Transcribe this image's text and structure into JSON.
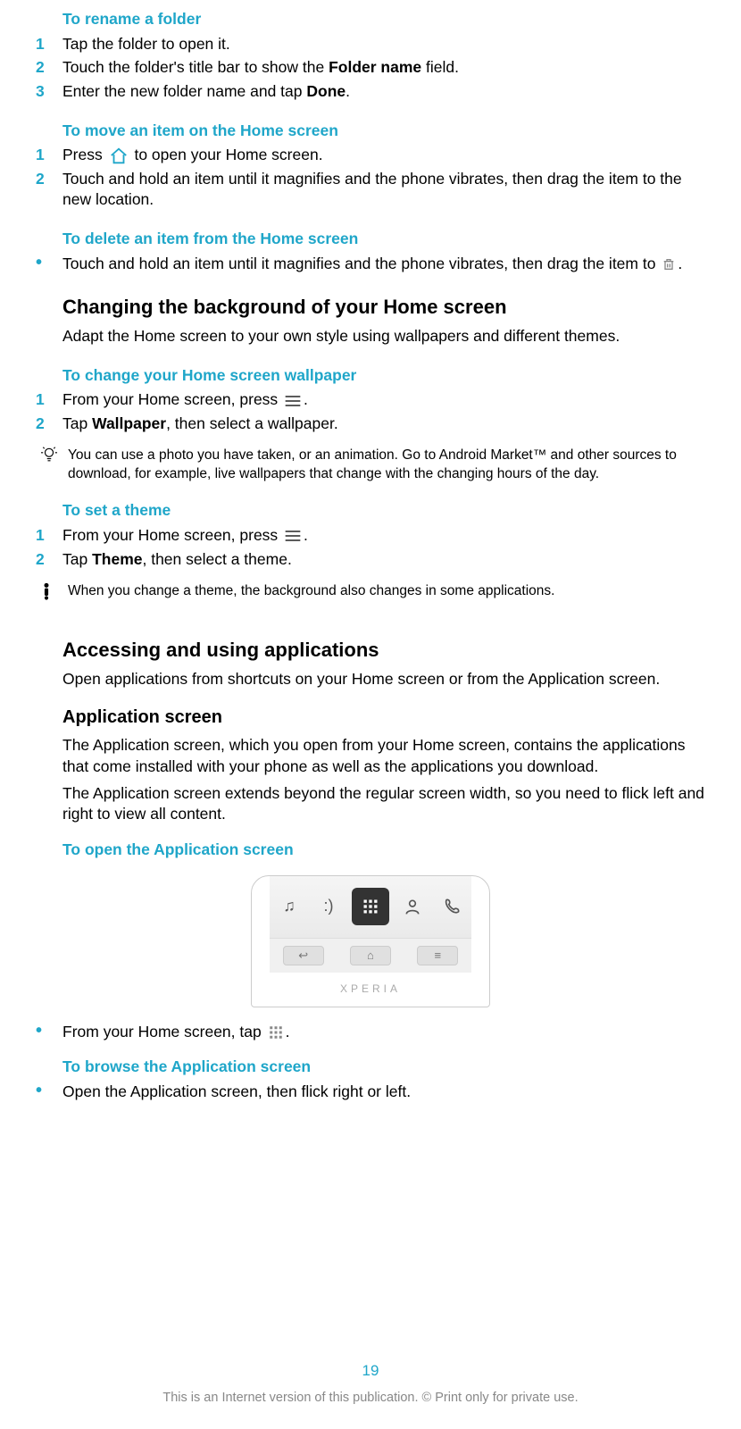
{
  "sec_rename": {
    "title": "To rename a folder",
    "s1_num": "1",
    "s1_txt": "Tap the folder to open it.",
    "s2_num": "2",
    "s2_pre": "Touch the folder's title bar to show the ",
    "s2_bold": "Folder name",
    "s2_post": " field.",
    "s3_num": "3",
    "s3_pre": "Enter the new folder name and tap ",
    "s3_bold": "Done",
    "s3_post": "."
  },
  "sec_move": {
    "title": "To move an item on the Home screen",
    "s1_num": "1",
    "s1_pre": "Press ",
    "s1_post": " to open your Home screen.",
    "s2_num": "2",
    "s2_txt": "Touch and hold an item until it magnifies and the phone vibrates, then drag the item to the new location."
  },
  "sec_delete": {
    "title": "To delete an item from the Home screen",
    "b1_pre": "Touch and hold an item until it magnifies and the phone vibrates, then drag the item to ",
    "b1_post": "."
  },
  "sec_bg": {
    "h2": "Changing the background of your Home screen",
    "para": "Adapt the Home screen to your own style using wallpapers and different themes."
  },
  "sec_wallpaper": {
    "title": "To change your Home screen wallpaper",
    "s1_num": "1",
    "s1_pre": "From your Home screen, press ",
    "s1_post": ".",
    "s2_num": "2",
    "s2_pre": "Tap ",
    "s2_bold": "Wallpaper",
    "s2_post": ", then select a wallpaper.",
    "tip": "You can use a photo you have taken, or an animation. Go to Android Market™ and other sources to download, for example, live wallpapers that change with the changing hours of the day."
  },
  "sec_theme": {
    "title": "To set a theme",
    "s1_num": "1",
    "s1_pre": "From your Home screen, press ",
    "s1_post": ".",
    "s2_num": "2",
    "s2_pre": "Tap ",
    "s2_bold": "Theme",
    "s2_post": ", then select a theme.",
    "note": "When you change a theme, the background also changes in some applications."
  },
  "sec_apps": {
    "h2": "Accessing and using applications",
    "para": "Open applications from shortcuts on your Home screen or from the Application screen."
  },
  "sec_appscreen": {
    "h3": "Application screen",
    "p1": "The Application screen, which you open from your Home screen, contains the applications that come installed with your phone as well as the applications you download.",
    "p2": "The Application screen extends beyond the regular screen width, so you need to flick left and right to view all content."
  },
  "sec_open": {
    "title": "To open the Application screen",
    "b1_pre": "From your Home screen, tap ",
    "b1_post": "."
  },
  "sec_browse": {
    "title": "To browse the Application screen",
    "b1": "Open the Application screen, then flick right or left."
  },
  "phone_brand": "XPERIA",
  "footer": {
    "page": "19",
    "notice": "This is an Internet version of this publication. © Print only for private use."
  }
}
